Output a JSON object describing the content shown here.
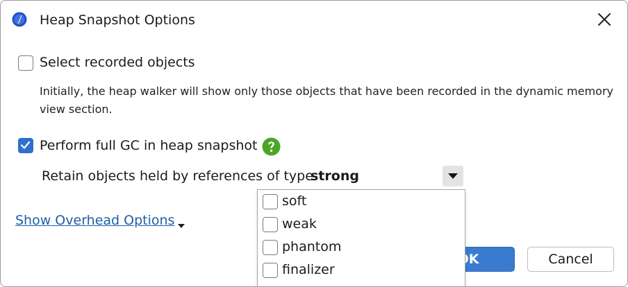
{
  "dialog": {
    "title": "Heap Snapshot Options",
    "app_icon": "app-logo-icon",
    "close_icon": "close-icon"
  },
  "options": {
    "select_recorded": {
      "label": "Select recorded objects",
      "checked": false,
      "description": "Initially, the heap walker will show only those objects that have been recorded in the dynamic memory view section."
    },
    "full_gc": {
      "label": "Perform full GC in heap snapshot",
      "checked": true,
      "help_icon": "help-icon"
    },
    "retain": {
      "label": "Retain objects held by references of type",
      "value": "strong"
    }
  },
  "reference_types_popup": {
    "items": [
      {
        "label": "soft",
        "checked": false
      },
      {
        "label": "weak",
        "checked": false
      },
      {
        "label": "phantom",
        "checked": false
      },
      {
        "label": "finalizer",
        "checked": false
      }
    ]
  },
  "footer": {
    "show_overhead_label": "Show Overhead Options",
    "ok_label": "OK",
    "cancel_label": "Cancel"
  },
  "colors": {
    "accent": "#3a7bd0",
    "link": "#1f5fa8",
    "help_green": "#4aa626"
  }
}
